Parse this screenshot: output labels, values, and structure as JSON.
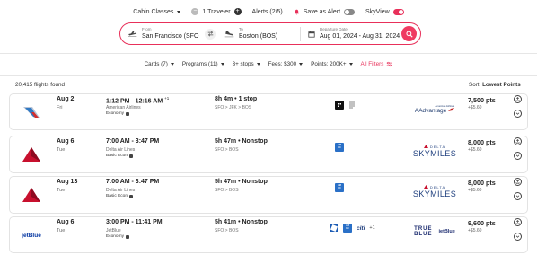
{
  "topbar": {
    "cabin": "Cabin Classes",
    "minus": "−",
    "travelers": "1 Traveler",
    "plus": "+",
    "alerts": "Alerts (2/5)",
    "save_alert": "Save as Alert",
    "skyview": "SkyView"
  },
  "search": {
    "from_label": "From",
    "from_value": "San Francisco (SFO",
    "to_label": "To",
    "to_value": "Boston (BOS)",
    "dates_label": "Departure Date",
    "dates_value": "Aug 01, 2024 - Aug 31, 2024"
  },
  "filters": {
    "cards": "Cards (7)",
    "programs": "Programs (11)",
    "stops": "3+ stops",
    "fees": "Fees: $300",
    "points": "Points: 200K+",
    "all": "All Filters"
  },
  "results": {
    "found": "20,415 flights found",
    "sort_label": "Sort:",
    "sort_value": "Lowest Points"
  },
  "colors": {
    "accent": "#e8305a",
    "delta_red": "#c8102e",
    "jetblue": "#0033a0"
  },
  "flights": [
    {
      "airline_icon": "american-airlines-icon",
      "date": "Aug 2",
      "dow": "Fri",
      "times": "1:12 PM - 12:16 AM",
      "plus_day": "+1",
      "duration": "8h 4m • 1 stop",
      "carrier": "American Airlines",
      "route": "SFO > JFK > BOS",
      "cabin": "Economy",
      "cards": [
        "bilt-card-icon"
      ],
      "program": "AAdvantage",
      "program_mini": "American Airlines",
      "points": "7,500 pts",
      "tax": "+$5.60"
    },
    {
      "airline_icon": "delta-icon",
      "date": "Aug 6",
      "dow": "Tue",
      "times": "7:00 AM - 3:47 PM",
      "duration": "5h 47m • Nonstop",
      "carrier": "Delta Air Lines",
      "route": "SFO > BOS",
      "cabin": "Basic Econ",
      "cards": [
        "amex-card-icon"
      ],
      "program_top": "DELTA",
      "program": "SKYMILES",
      "points": "8,000 pts",
      "tax": "+$5.60"
    },
    {
      "airline_icon": "delta-icon",
      "date": "Aug 13",
      "dow": "Tue",
      "times": "7:00 AM - 3:47 PM",
      "duration": "5h 47m • Nonstop",
      "carrier": "Delta Air Lines",
      "route": "SFO > BOS",
      "cabin": "Basic Econ",
      "cards": [
        "amex-card-icon"
      ],
      "program_top": "DELTA",
      "program": "SKYMILES",
      "points": "8,000 pts",
      "tax": "+$5.60"
    },
    {
      "airline_icon": "jetblue-icon",
      "airline_logo_text": "jetBlue",
      "date": "Aug 6",
      "dow": "Tue",
      "times": "3:00 PM - 11:41 PM",
      "duration": "5h 41m • Nonstop",
      "carrier": "JetBlue",
      "route": "SFO > BOS",
      "cabin": "Economy",
      "cards": [
        "chase-card-icon",
        "amex-card-icon",
        "citi-card-icon"
      ],
      "cards_citi_text": "citi",
      "cards_more": "+1",
      "program_tb1": "TRUE",
      "program_tb2": "BLUE",
      "program": "jetBlue",
      "points": "9,600 pts",
      "tax": "+$5.60"
    }
  ]
}
